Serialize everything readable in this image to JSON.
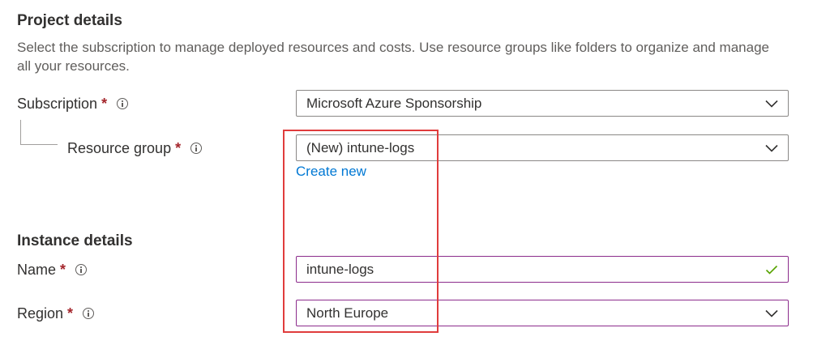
{
  "project": {
    "title": "Project details",
    "description": "Select the subscription to manage deployed resources and costs. Use resource groups like folders to organize and manage all your resources."
  },
  "subscription": {
    "label": "Subscription",
    "required": "*",
    "value": "Microsoft Azure Sponsorship"
  },
  "resource_group": {
    "label": "Resource group",
    "required": "*",
    "value": "(New) intune-logs",
    "create_new": "Create new"
  },
  "instance": {
    "title": "Instance details"
  },
  "name": {
    "label": "Name",
    "required": "*",
    "value": "intune-logs"
  },
  "region": {
    "label": "Region",
    "required": "*",
    "value": "North Europe"
  },
  "colors": {
    "link": "#0078d4",
    "required": "#a4262c",
    "valid_check": "#57a300",
    "highlight": "#e03c3c",
    "active_border": "#8c2c8c"
  },
  "icons": [
    "info-icon",
    "chevron-down-icon",
    "checkmark-icon"
  ]
}
